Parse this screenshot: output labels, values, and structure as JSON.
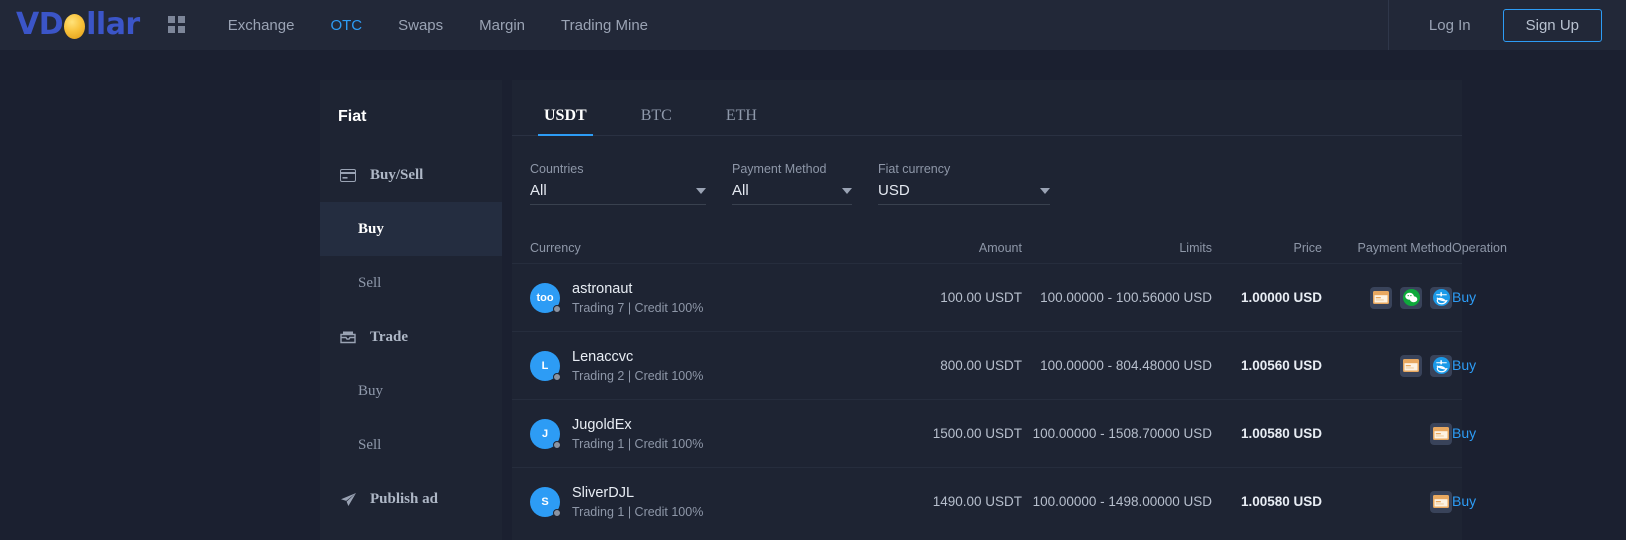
{
  "header": {
    "logo_text_1": "VD",
    "logo_text_2": "llar",
    "grid_icon": "grid-icon",
    "nav": [
      {
        "label": "Exchange",
        "active": false
      },
      {
        "label": "OTC",
        "active": true
      },
      {
        "label": "Swaps",
        "active": false
      },
      {
        "label": "Margin",
        "active": false
      },
      {
        "label": "Trading Mine",
        "active": false
      }
    ],
    "login_label": "Log In",
    "signup_label": "Sign Up",
    "accent_color": "#2d9cf5"
  },
  "sidebar": {
    "title": "Fiat",
    "items": [
      {
        "label": "Buy/Sell",
        "icon": "card-icon",
        "type": "group",
        "active": false
      },
      {
        "label": "Buy",
        "icon": "",
        "type": "sub",
        "active": true
      },
      {
        "label": "Sell",
        "icon": "",
        "type": "sub",
        "active": false
      },
      {
        "label": "Trade",
        "icon": "inbox-icon",
        "type": "group",
        "active": false
      },
      {
        "label": "Buy",
        "icon": "",
        "type": "sub",
        "active": false
      },
      {
        "label": "Sell",
        "icon": "",
        "type": "sub",
        "active": false
      },
      {
        "label": "Publish ad",
        "icon": "send-icon",
        "type": "group",
        "active": false
      }
    ]
  },
  "main": {
    "tabs": [
      {
        "label": "USDT",
        "active": true
      },
      {
        "label": "BTC",
        "active": false
      },
      {
        "label": "ETH",
        "active": false
      }
    ],
    "filters": [
      {
        "label": "Countries",
        "value": "All",
        "width_class": "w-countries",
        "name": "countries"
      },
      {
        "label": "Payment Method",
        "value": "All",
        "width_class": "w-payment",
        "name": "payment-method"
      },
      {
        "label": "Fiat currency",
        "value": "USD",
        "width_class": "w-fiat",
        "name": "fiat-currency"
      }
    ],
    "table": {
      "columns": [
        "Currency",
        "Amount",
        "Limits",
        "Price",
        "Payment Method",
        "Operation"
      ],
      "rows": [
        {
          "avatar_text": "too",
          "name": "astronaut",
          "meta": "Trading 7 | Credit 100%",
          "amount": "100.00 USDT",
          "limits": "100.00000 - 100.56000 USD",
          "price": "1.00000 USD",
          "payment_methods": [
            "bank-card",
            "wechat-pay",
            "alipay"
          ],
          "operation": "Buy"
        },
        {
          "avatar_text": "L",
          "name": "Lenaccvc",
          "meta": "Trading 2 | Credit 100%",
          "amount": "800.00 USDT",
          "limits": "100.00000 - 804.48000 USD",
          "price": "1.00560 USD",
          "payment_methods": [
            "bank-card",
            "alipay"
          ],
          "operation": "Buy"
        },
        {
          "avatar_text": "J",
          "name": "JugoldEx",
          "meta": "Trading 1 | Credit 100%",
          "amount": "1500.00 USDT",
          "limits": "100.00000 - 1508.70000 USD",
          "price": "1.00580 USD",
          "payment_methods": [
            "bank-card"
          ],
          "operation": "Buy"
        },
        {
          "avatar_text": "S",
          "name": "SliverDJL",
          "meta": "Trading 1 | Credit 100%",
          "amount": "1490.00 USDT",
          "limits": "100.00000 - 1498.00000 USD",
          "price": "1.00580 USD",
          "payment_methods": [
            "bank-card"
          ],
          "operation": "Buy"
        }
      ]
    }
  }
}
